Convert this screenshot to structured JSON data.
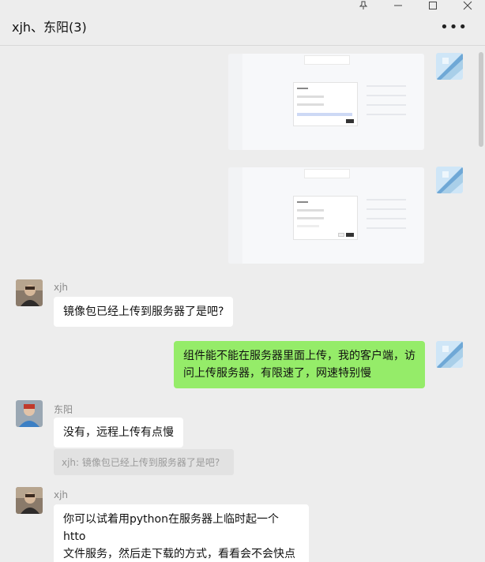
{
  "window": {
    "controls": [
      "pin-icon",
      "minimize-icon",
      "maximize-icon",
      "close-icon"
    ]
  },
  "header": {
    "title": "xjh、东阳(3)",
    "more_label": "•••"
  },
  "messages": {
    "m3_sender": "xjh",
    "m3_text": "镜像包已经上传到服务器了是吧?",
    "m4_line1": "组件能不能在服务器里面上传，我的客户端，访",
    "m4_line2": "问上传服务器，有限速了，网速特别慢",
    "m5_sender": "东阳",
    "m5_text": "没有，远程上传有点慢",
    "m5_quote": "xjh: 镜像包已经上传到服务器了是吧?",
    "m6_sender": "xjh",
    "m6_line1": "你可以试着用python在服务器上临时起一个htto",
    "m6_line2": "文件服务，然后走下载的方式，看看会不会快点"
  },
  "colors": {
    "background": "#ededed",
    "my_bubble": "#95ec69",
    "their_bubble": "#ffffff",
    "quote_bg": "#e2e2e2"
  }
}
